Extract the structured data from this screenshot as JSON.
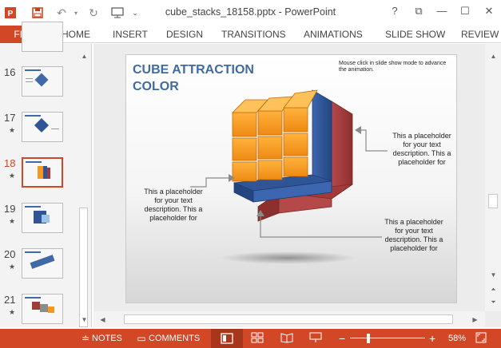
{
  "window": {
    "title": "cube_stacks_18158.pptx - PowerPoint",
    "help": "?",
    "restore": "⧉",
    "minimize": "—",
    "maximize": "☐",
    "close": "✕"
  },
  "ribbon": {
    "tabs": [
      "FILE",
      "HOME",
      "INSERT",
      "DESIGN",
      "TRANSITIONS",
      "ANIMATIONS",
      "SLIDE SHOW",
      "REVIEW"
    ]
  },
  "thumbnails": [
    {
      "number": "16",
      "star": ""
    },
    {
      "number": "17",
      "star": "★"
    },
    {
      "number": "18",
      "star": "★"
    },
    {
      "number": "19",
      "star": "★"
    },
    {
      "number": "20",
      "star": "★"
    },
    {
      "number": "21",
      "star": "★"
    }
  ],
  "slide": {
    "title_line1": "CUBE ATTRACTION",
    "title_line2": "COLOR",
    "note": "Mouse click in slide show mode to advance the animation.",
    "placeholder_left": "This a placeholder for your text description. This a placeholder for",
    "placeholder_right": "This a placeholder for your text description. This a placeholder for",
    "placeholder_bottom": "This a placeholder for your text description. This a placeholder for",
    "colors": {
      "orange": "#f5981f",
      "blue": "#2f5597",
      "red": "#a33a3a",
      "title": "#3f6aa6"
    }
  },
  "statusbar": {
    "notes": "NOTES",
    "comments": "COMMENTS",
    "zoom": "58%",
    "minus": "−",
    "plus": "+"
  }
}
